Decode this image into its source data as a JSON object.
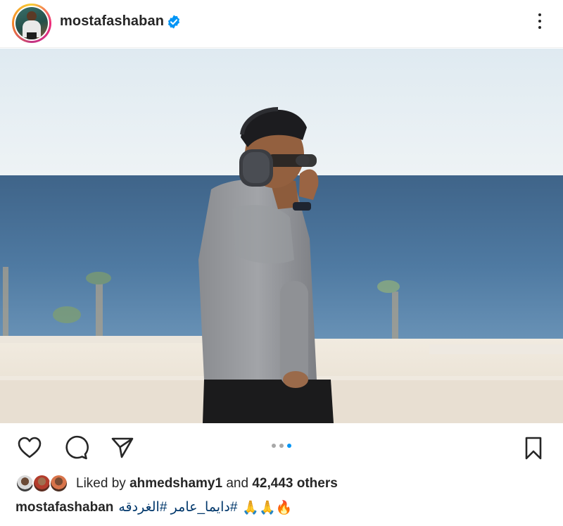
{
  "post": {
    "username": "mostafashaban",
    "verified": true,
    "more_icon": "more-vertical-icon",
    "photo_alt": "",
    "carousel": {
      "count": 3,
      "active_index": 2
    },
    "actions": {
      "like_icon": "heart-icon",
      "comment_icon": "comment-icon",
      "share_icon": "send-icon",
      "save_icon": "bookmark-icon"
    },
    "likes": {
      "prefix": "Liked by",
      "user": "ahmedshamy1",
      "connector": "and",
      "count_text": "42,443 others"
    },
    "caption": {
      "username": "mostafashaban",
      "hashtags": "#دايما_عامر #الغردقه",
      "emoji": "🙏🙏🔥"
    }
  },
  "colors": {
    "text": "#262626",
    "verified": "#0095f6",
    "active_dot": "#0095f6",
    "inactive_dot": "#a8a8a8",
    "hashtag": "#00376b"
  }
}
